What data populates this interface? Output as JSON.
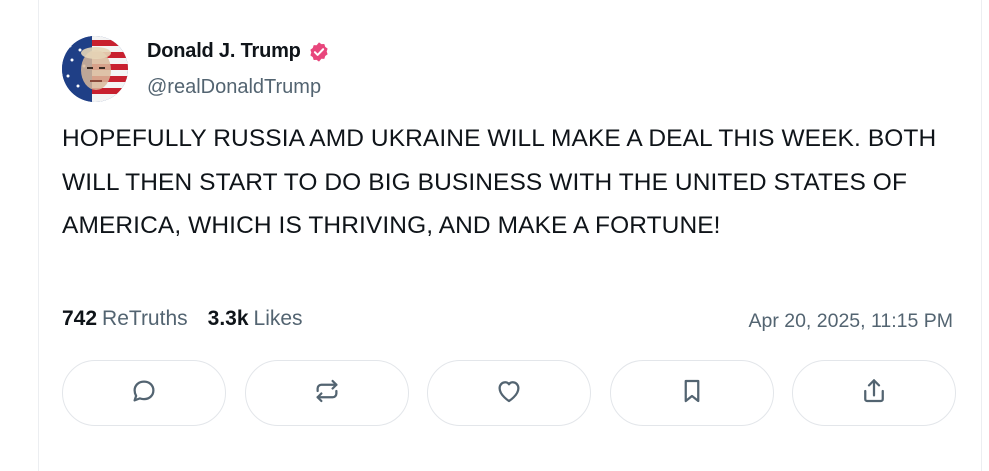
{
  "post": {
    "author": {
      "name": "Donald J. Trump",
      "handle": "@realDonaldTrump",
      "verified": true,
      "verified_color": "#e8467c"
    },
    "text": "HOPEFULLY RUSSIA AMD UKRAINE WILL MAKE A DEAL THIS WEEK. BOTH WILL THEN START TO DO BIG BUSINESS WITH THE UNITED STATES OF AMERICA, WHICH IS THRIVING, AND MAKE A FORTUNE!",
    "stats": {
      "retruths_count": "742",
      "retruths_label": "ReTruths",
      "likes_count": "3.3k",
      "likes_label": "Likes"
    },
    "timestamp": "Apr 20, 2025, 11:15 PM"
  },
  "actions": [
    {
      "icon": "reply-icon"
    },
    {
      "icon": "retruth-icon"
    },
    {
      "icon": "heart-icon"
    },
    {
      "icon": "bookmark-icon"
    },
    {
      "icon": "share-icon"
    }
  ]
}
